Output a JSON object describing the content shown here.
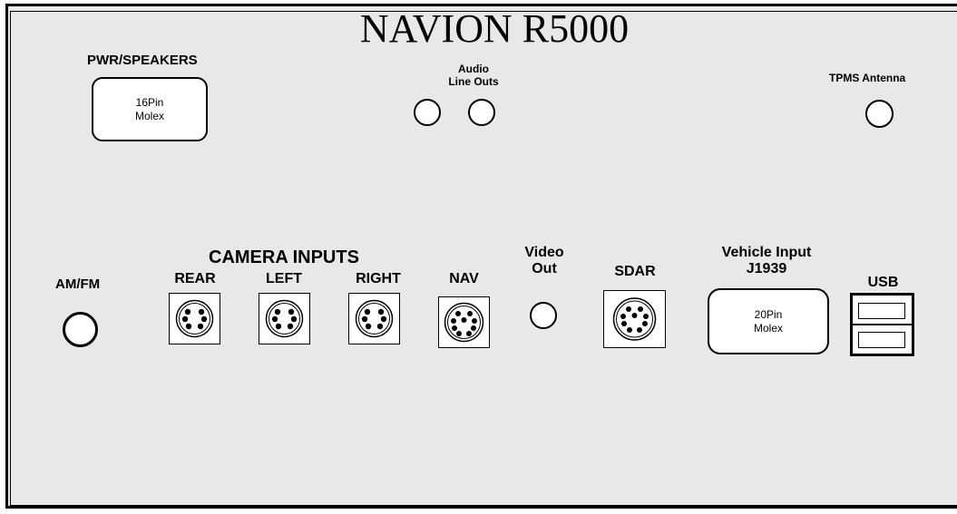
{
  "title": "NAVION R5000",
  "pwr": {
    "label": "PWR/SPEAKERS",
    "line1": "16Pin",
    "line2": "Molex"
  },
  "audio": {
    "line1": "Audio",
    "line2": "Line Outs"
  },
  "tpms": {
    "label": "TPMS Antenna"
  },
  "amfm": {
    "label": "AM/FM"
  },
  "camera": {
    "heading": "CAMERA INPUTS",
    "rear": "REAR",
    "left": "LEFT",
    "right": "RIGHT"
  },
  "nav": {
    "label": "NAV"
  },
  "video": {
    "line1": "Video",
    "line2": "Out"
  },
  "sdar": {
    "label": "SDAR"
  },
  "vehicle": {
    "line1": "Vehicle Input",
    "line2": "J1939",
    "box1": "20Pin",
    "box2": "Molex"
  },
  "usb": {
    "label": "USB"
  },
  "colors": {
    "panel": "#e8e8e8",
    "line": "#000000",
    "connector": "#ffffff"
  }
}
